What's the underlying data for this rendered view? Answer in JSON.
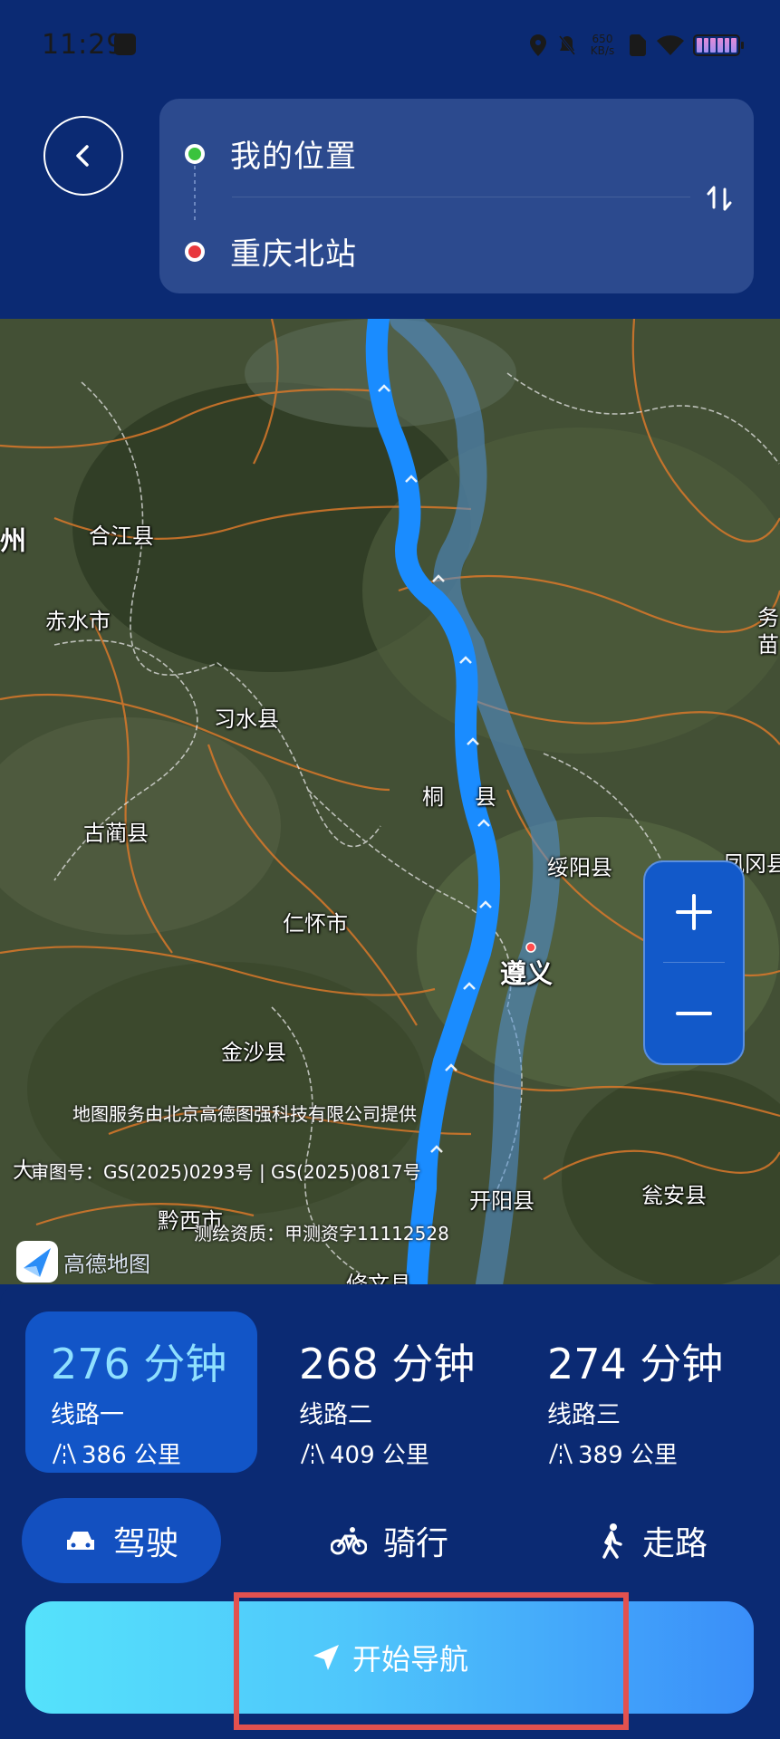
{
  "status_bar": {
    "time": "11:29",
    "net_speed_value": "650",
    "net_speed_unit": "KB/s",
    "icons": [
      "location-icon",
      "mute-icon",
      "sim-icon",
      "wifi-icon",
      "battery-icon"
    ]
  },
  "header": {
    "back_icon": "chevron-left-icon",
    "origin": "我的位置",
    "destination": "重庆北站",
    "swap_icon": "swap-vertical-icon"
  },
  "map": {
    "labels": {
      "hejiang": "合江县",
      "chishui": "赤水市",
      "xishui": "习水县",
      "gulin": "古蔺县",
      "tongzi_a": "桐",
      "tongzi_b": "县",
      "suiyang": "绥阳县",
      "renhuai": "仁怀市",
      "zunyi": "遵义",
      "jinsha": "金沙县",
      "qianxi": "黔西市",
      "kaiyang": "开阳县",
      "wengan": "瓮安县",
      "xiuwen": "修文县",
      "fenggang": "凤冈县",
      "edge_left_zhou": "州",
      "edge_left_da": "大",
      "edge_right_wu": "务",
      "edge_right_miao": "苗"
    },
    "credits": {
      "provider": "地图服务由北京高德图强科技有限公司提供",
      "review": "审图号：GS(2025)0293号 | GS(2025)0817号",
      "survey": "测绘资质：甲测资字11112528"
    },
    "logo_text": "高德地图",
    "zoom_in_label": "+",
    "zoom_out_label": "−"
  },
  "routes": [
    {
      "time": "276 分钟",
      "name": "线路一",
      "distance": "386 公里",
      "selected": true
    },
    {
      "time": "268 分钟",
      "name": "线路二",
      "distance": "409 公里",
      "selected": false
    },
    {
      "time": "274 分钟",
      "name": "线路三",
      "distance": "389 公里",
      "selected": false
    }
  ],
  "modes": [
    {
      "label": "驾驶",
      "icon": "car-icon",
      "selected": true
    },
    {
      "label": "骑行",
      "icon": "bicycle-icon",
      "selected": false
    },
    {
      "label": "走路",
      "icon": "walk-icon",
      "selected": false
    }
  ],
  "start_button": {
    "label": "开始导航",
    "icon": "navigation-arrow-icon"
  },
  "colors": {
    "background": "#0b2a73",
    "card": "#2c4a8e",
    "selected": "#1255c7",
    "route_primary": "#1a8cff",
    "route_alt": "#4f8fd6",
    "accent_text": "#8fe0ff",
    "button_gradient_start": "#55e2fb",
    "button_gradient_end": "#3a8ef9",
    "highlight": "#e2514f"
  }
}
